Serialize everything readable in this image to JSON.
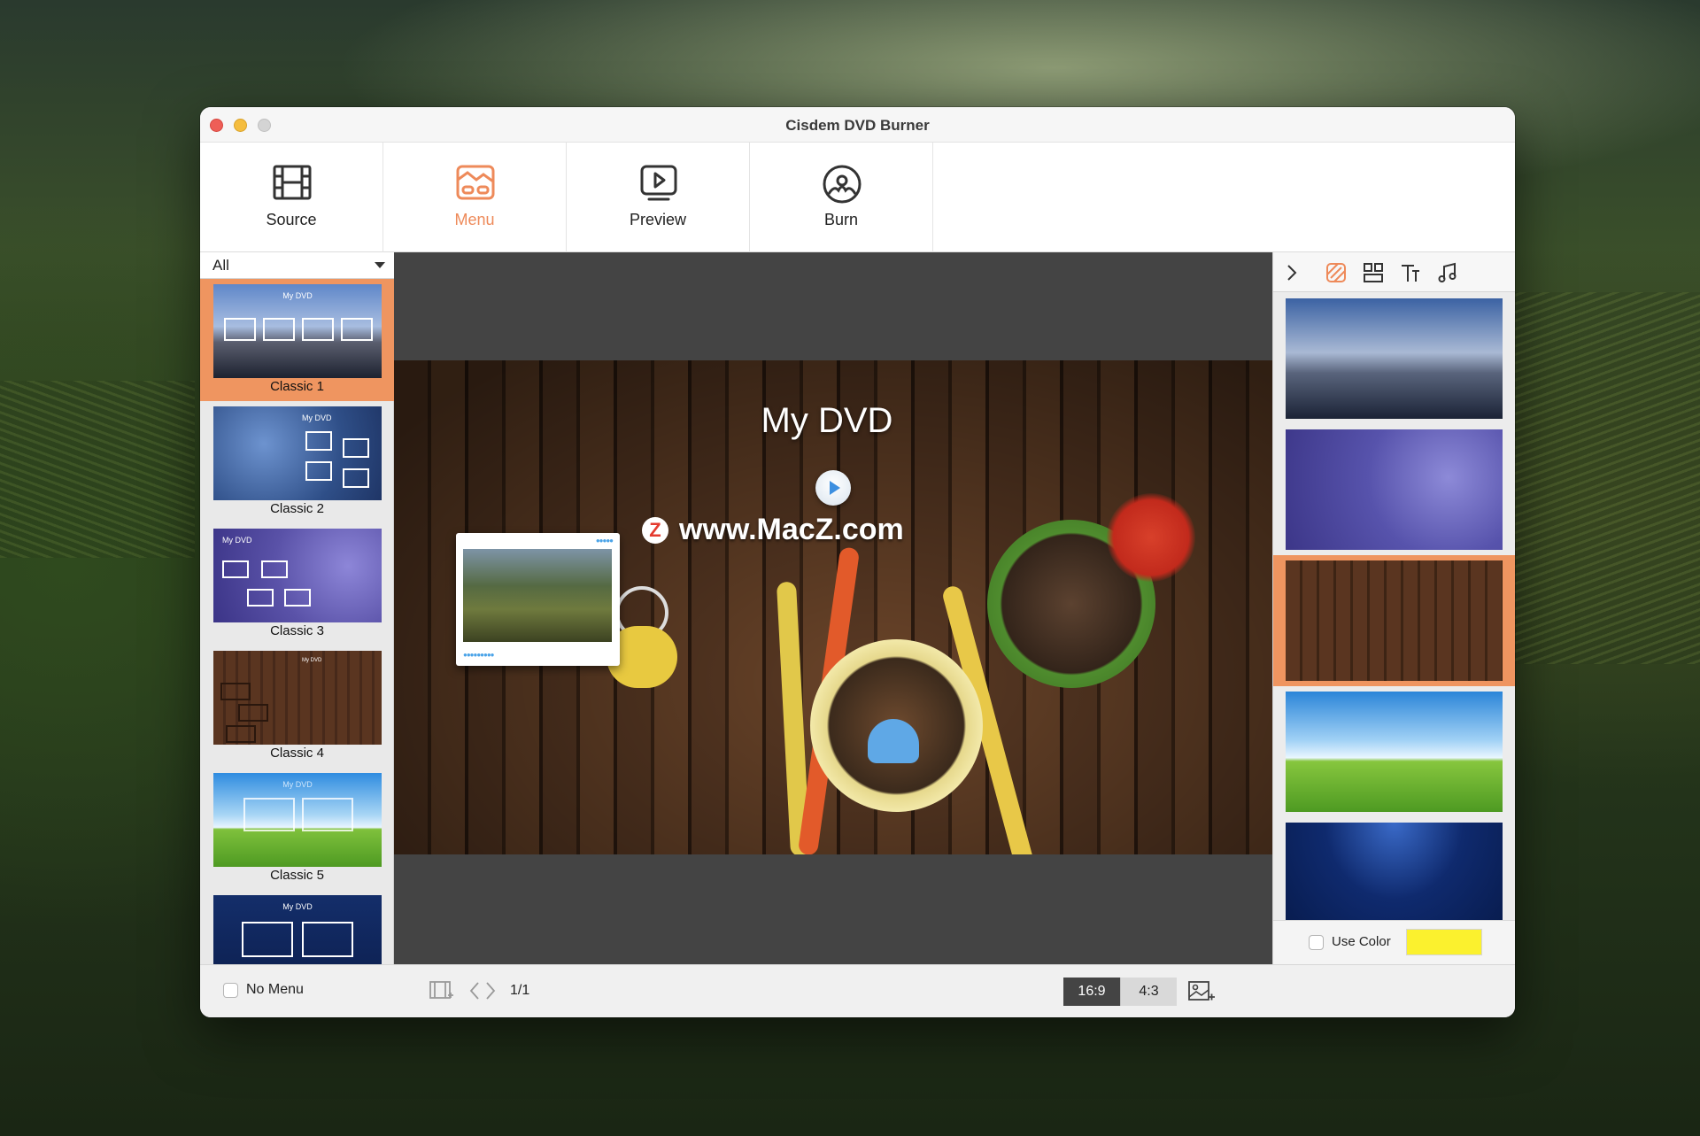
{
  "window": {
    "title": "Cisdem DVD Burner"
  },
  "toolbar": {
    "items": [
      {
        "label": "Source",
        "icon": "film-icon",
        "active": false
      },
      {
        "label": "Menu",
        "icon": "menu-template-icon",
        "active": true
      },
      {
        "label": "Preview",
        "icon": "play-screen-icon",
        "active": false
      },
      {
        "label": "Burn",
        "icon": "disc-burn-icon",
        "active": false
      }
    ]
  },
  "templates": {
    "filter": "All",
    "items": [
      {
        "label": "Classic 1",
        "mini_title": "My DVD",
        "selected": true
      },
      {
        "label": "Classic 2",
        "mini_title": "My DVD",
        "selected": false
      },
      {
        "label": "Classic 3",
        "mini_title": "My DVD",
        "selected": false
      },
      {
        "label": "Classic 4",
        "mini_title": "My DVD",
        "selected": false
      },
      {
        "label": "Classic 5",
        "mini_title": "My DVD",
        "selected": false
      },
      {
        "label": "",
        "mini_title": "My DVD",
        "selected": false
      }
    ]
  },
  "stage": {
    "title": "My DVD",
    "watermark": "www.MacZ.com",
    "watermark_logo": "Z"
  },
  "right_panel": {
    "tabs": [
      "collapse-chevron-icon",
      "background-icon",
      "layout-icon",
      "text-icon",
      "music-icon"
    ],
    "backgrounds": [
      {
        "name": "city-skyline",
        "selected": false
      },
      {
        "name": "purple-flowers",
        "selected": false
      },
      {
        "name": "wooden-table",
        "selected": true
      },
      {
        "name": "green-field",
        "selected": false
      },
      {
        "name": "blue-space",
        "selected": false
      }
    ],
    "use_color_label": "Use Color",
    "color": "#fbf12e"
  },
  "bottom_bar": {
    "no_menu_label": "No Menu",
    "page_count": "1/1",
    "ratio_169": "16:9",
    "ratio_43": "4:3",
    "active_ratio": "16:9"
  },
  "colors": {
    "accent": "#ef9560",
    "accent_text": "#ee8a5a"
  }
}
